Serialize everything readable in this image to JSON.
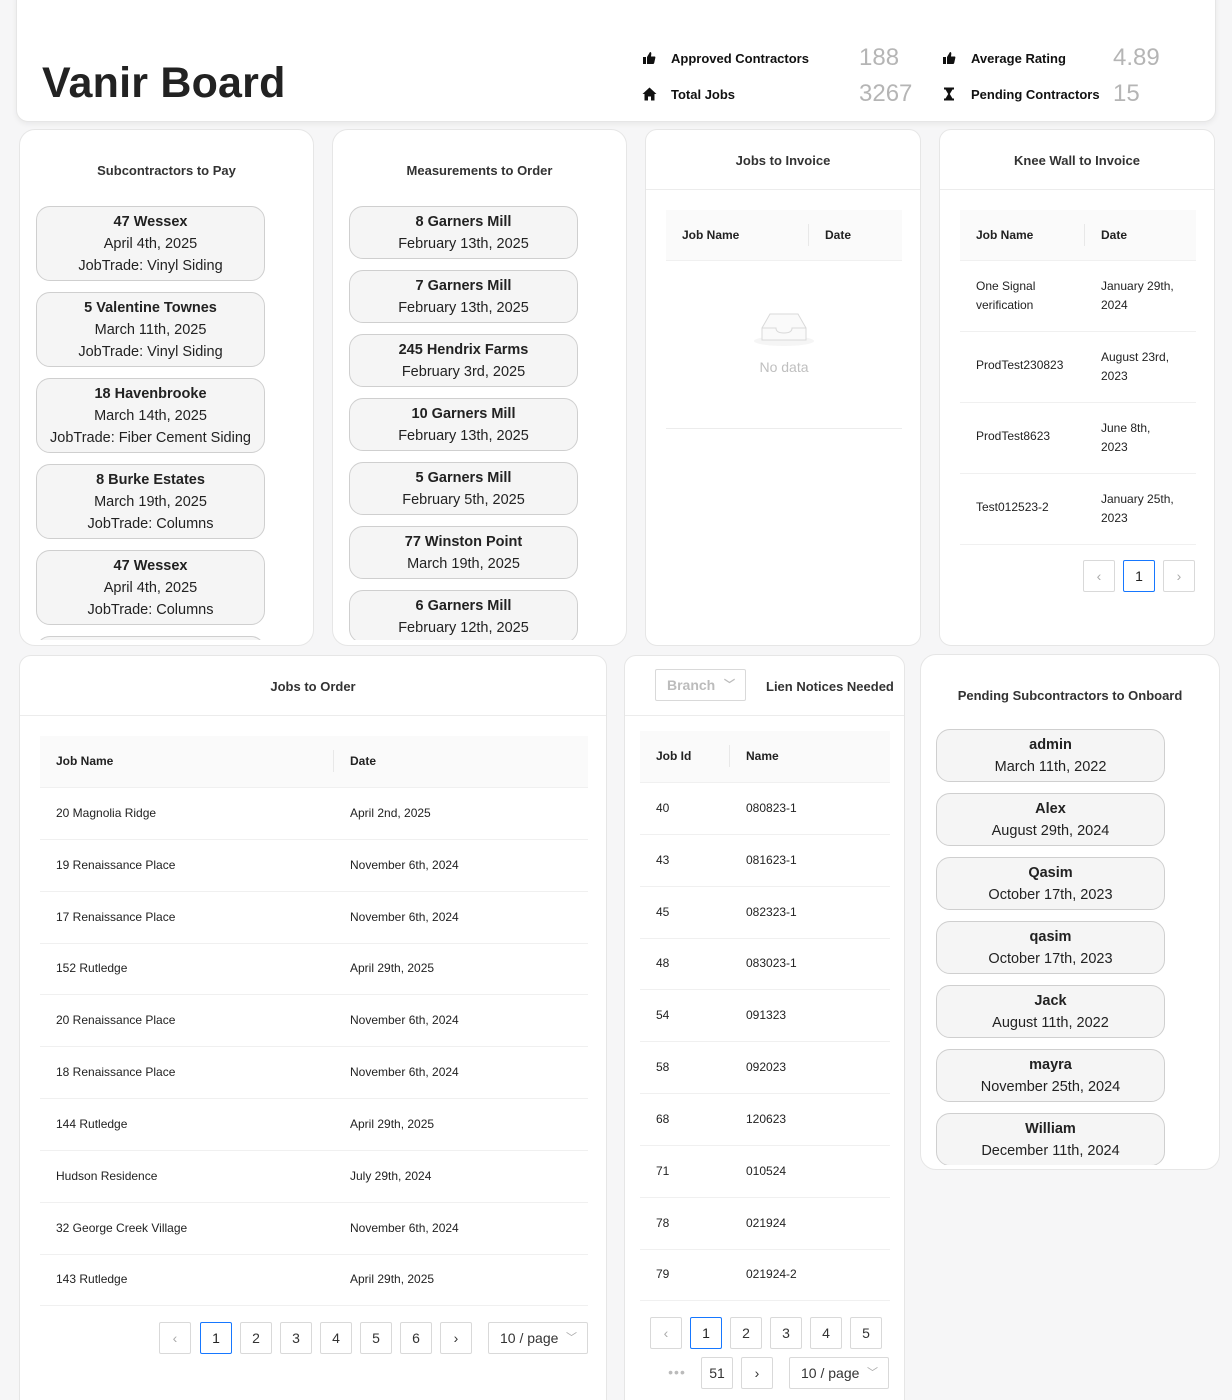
{
  "header": {
    "title": "Vanir Board",
    "stats": [
      {
        "label": "Approved Contractors",
        "value": "188",
        "icon": "thumbs-up-icon"
      },
      {
        "label": "Total Jobs",
        "value": "3267",
        "icon": "home-icon"
      },
      {
        "label": "Average Rating",
        "value": "4.89",
        "icon": "thumbs-up-icon"
      },
      {
        "label": "Pending Contractors",
        "value": "15",
        "icon": "hourglass-icon"
      }
    ]
  },
  "subcontractors_to_pay": {
    "title": "Subcontractors to Pay",
    "items": [
      {
        "name": "47 Wessex",
        "date": "April 4th, 2025",
        "trade": "JobTrade: Vinyl Siding"
      },
      {
        "name": "5 Valentine Townes",
        "date": "March 11th, 2025",
        "trade": "JobTrade: Vinyl Siding"
      },
      {
        "name": "18 Havenbrooke",
        "date": "March 14th, 2025",
        "trade": "JobTrade: Fiber Cement Siding"
      },
      {
        "name": "8 Burke Estates",
        "date": "March 19th, 2025",
        "trade": "JobTrade: Columns"
      },
      {
        "name": "47 Wessex",
        "date": "April 4th, 2025",
        "trade": "JobTrade: Columns"
      }
    ]
  },
  "measurements_to_order": {
    "title": "Measurements to Order",
    "items": [
      {
        "name": "8 Garners Mill",
        "date": "February 13th, 2025"
      },
      {
        "name": "7 Garners Mill",
        "date": "February 13th, 2025"
      },
      {
        "name": "245 Hendrix Farms",
        "date": "February 3rd, 2025"
      },
      {
        "name": "10 Garners Mill",
        "date": "February 13th, 2025"
      },
      {
        "name": "5 Garners Mill",
        "date": "February 5th, 2025"
      },
      {
        "name": "77 Winston Point",
        "date": "March 19th, 2025"
      },
      {
        "name": "6 Garners Mill",
        "date": "February 12th, 2025"
      }
    ]
  },
  "jobs_to_invoice": {
    "title": "Jobs to Invoice",
    "columns": [
      "Job Name",
      "Date"
    ],
    "empty_text": "No data"
  },
  "knee_wall": {
    "title": "Knee Wall to Invoice",
    "columns": [
      "Job Name",
      "Date"
    ],
    "rows": [
      {
        "name1": "One Signal",
        "name2": "verification",
        "date1": "January 29th,",
        "date2": "2024"
      },
      {
        "name1": "ProdTest230823",
        "name2": "",
        "date1": "August 23rd,",
        "date2": "2023"
      },
      {
        "name1": "ProdTest8623",
        "name2": "",
        "date1": "June 8th,",
        "date2": "2023"
      },
      {
        "name1": "Test012523-2",
        "name2": "",
        "date1": "January 25th,",
        "date2": "2023"
      }
    ],
    "pagination": {
      "prev": "‹",
      "pages": [
        "1"
      ],
      "next": "›"
    }
  },
  "jobs_to_order": {
    "title": "Jobs to Order",
    "columns": [
      "Job Name",
      "Date"
    ],
    "rows": [
      {
        "name": "20 Magnolia Ridge",
        "date": "April 2nd, 2025"
      },
      {
        "name": "19 Renaissance Place",
        "date": "November 6th, 2024"
      },
      {
        "name": "17 Renaissance Place",
        "date": "November 6th, 2024"
      },
      {
        "name": "152 Rutledge",
        "date": "April 29th, 2025"
      },
      {
        "name": "20 Renaissance Place",
        "date": "November 6th, 2024"
      },
      {
        "name": "18 Renaissance Place",
        "date": "November 6th, 2024"
      },
      {
        "name": "144 Rutledge",
        "date": "April 29th, 2025"
      },
      {
        "name": "Hudson Residence",
        "date": "July 29th, 2024"
      },
      {
        "name": "32 George Creek Village",
        "date": "November 6th, 2024"
      },
      {
        "name": "143 Rutledge",
        "date": "April 29th, 2025"
      }
    ],
    "pagination": {
      "prev": "‹",
      "pages": [
        "1",
        "2",
        "3",
        "4",
        "5",
        "6"
      ],
      "next": "›",
      "page_size": "10 / page"
    }
  },
  "lien_notices": {
    "title": "Lien Notices Needed",
    "branch_placeholder": "Branch",
    "columns": [
      "Job Id",
      "Name"
    ],
    "rows": [
      {
        "id": "40",
        "name": "080823-1"
      },
      {
        "id": "43",
        "name": "081623-1"
      },
      {
        "id": "45",
        "name": "082323-1"
      },
      {
        "id": "48",
        "name": "083023-1"
      },
      {
        "id": "54",
        "name": "091323"
      },
      {
        "id": "58",
        "name": "092023"
      },
      {
        "id": "68",
        "name": "120623"
      },
      {
        "id": "71",
        "name": "010524"
      },
      {
        "id": "78",
        "name": "021924"
      },
      {
        "id": "79",
        "name": "021924-2"
      }
    ],
    "pagination": {
      "prev": "‹",
      "pages": [
        "1",
        "2",
        "3",
        "4",
        "5"
      ],
      "ellipsis": "•••",
      "last": "51",
      "next": "›",
      "page_size": "10 / page"
    }
  },
  "pending_subcontractors": {
    "title": "Pending Subcontractors to Onboard",
    "items": [
      {
        "name": "admin",
        "date": "March 11th, 2022"
      },
      {
        "name": "Alex",
        "date": "August 29th, 2024"
      },
      {
        "name": "Qasim",
        "date": "October 17th, 2023"
      },
      {
        "name": "qasim",
        "date": "October 17th, 2023"
      },
      {
        "name": "Jack",
        "date": "August 11th, 2022"
      },
      {
        "name": "mayra",
        "date": "November 25th, 2024"
      },
      {
        "name": "William",
        "date": "December 11th, 2024"
      }
    ]
  }
}
